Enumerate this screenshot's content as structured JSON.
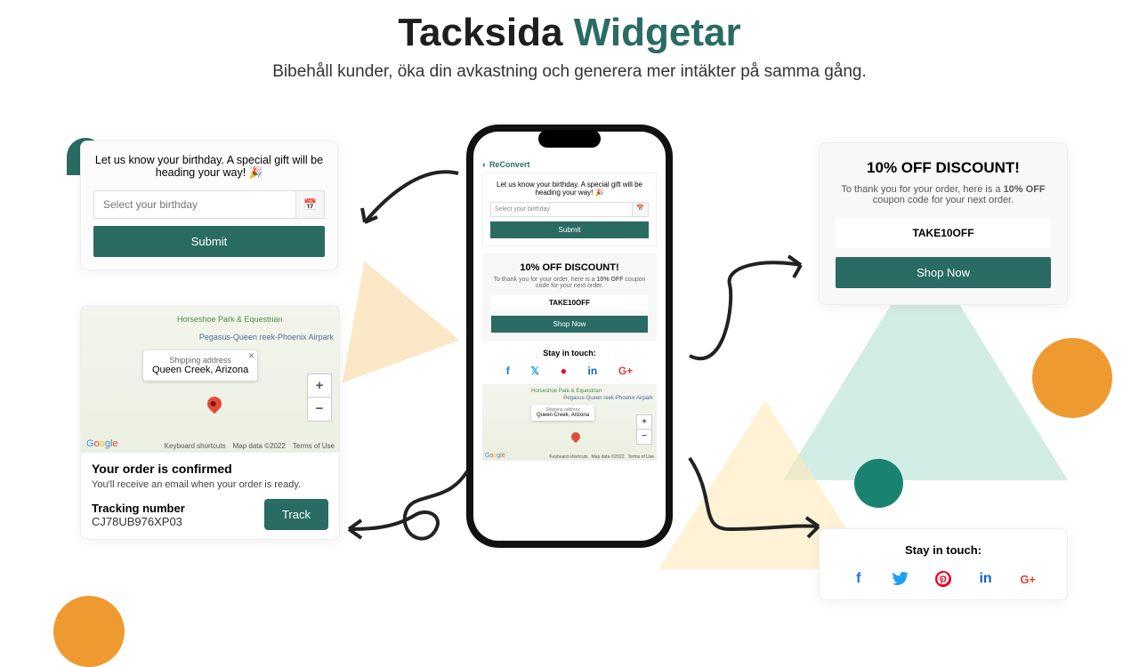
{
  "header": {
    "title1": "Tacksida",
    "title2": "Widgetar",
    "subtitle": "Bibehåll kunder, öka din avkastning och generera mer intäkter på samma gång."
  },
  "birthday": {
    "title": "Let us know your birthday. A special gift will be heading your way! 🎉",
    "placeholder": "Select your birthday",
    "submit": "Submit"
  },
  "map": {
    "poi1": "Horseshoe Park & Equestrian",
    "poi2": "Pegasus-Queen reek-Phoenix Airpark",
    "ship_label": "Shipping address",
    "ship_addr": "Queen Creek, Arizona",
    "shortcuts": "Keyboard shortcuts",
    "mapdata": "Map data ©2022",
    "terms": "Terms of Use"
  },
  "order": {
    "confirmed": "Your order is confirmed",
    "email": "You'll receive an email when your order is ready.",
    "tn_label": "Tracking number",
    "tn_code": "CJ78UB976XP03",
    "track": "Track"
  },
  "discount": {
    "title": "10% OFF DISCOUNT!",
    "desc_1": "To thank you for your order, here is a ",
    "desc_bold": "10% OFF",
    "desc_2": " coupon code for your next order.",
    "code": "TAKE10OFF",
    "shop": "Shop Now"
  },
  "social": {
    "title": "Stay in touch:"
  },
  "phone": {
    "logo": "ReConvert"
  }
}
